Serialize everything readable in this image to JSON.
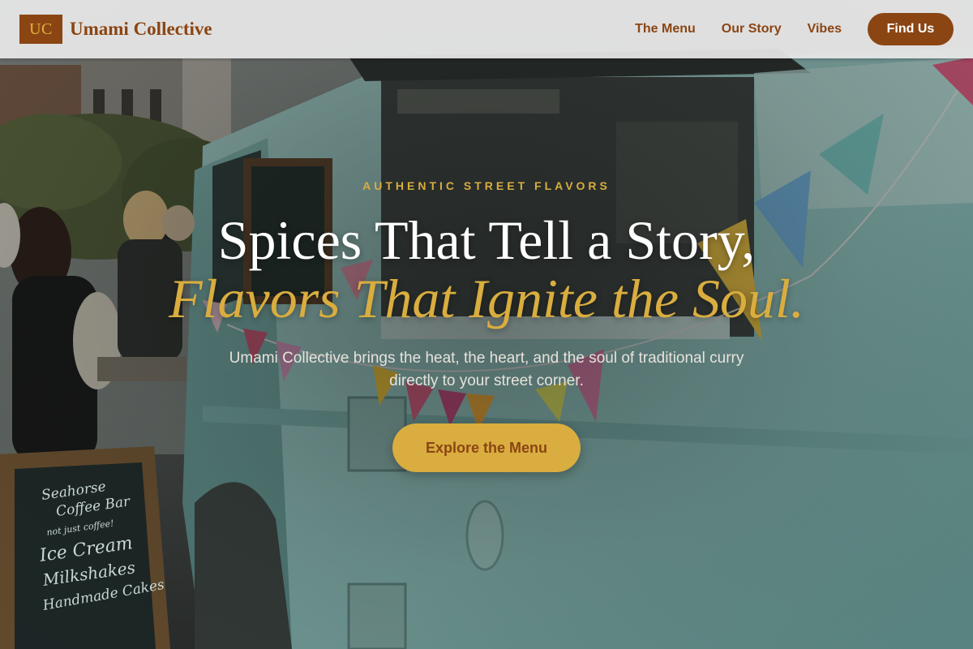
{
  "header": {
    "logo_mark": "UC",
    "brand_name": "Umami Collective",
    "nav": [
      {
        "label": "The Menu"
      },
      {
        "label": "Our Story"
      },
      {
        "label": "Vibes"
      }
    ],
    "cta_label": "Find Us"
  },
  "hero": {
    "eyebrow": "AUTHENTIC STREET FLAVORS",
    "headline_line1": "Spices That Tell a Story,",
    "headline_line2": "Flavors That Ignite the Soul.",
    "subtext": "Umami Collective brings the heat, the heart, and the soul of traditional curry directly to your street corner.",
    "cta_label": "Explore the Menu",
    "background_image": "food-truck-photo",
    "sandwich_board": [
      "Seahorse",
      "Coffee Bar",
      "not just coffee!",
      "Ice Cream",
      "Milkshakes",
      "Handmade Cakes"
    ]
  },
  "colors": {
    "brand_brown": "#8b4513",
    "accent_gold": "#d9ad3f",
    "header_bg": "#e8e8e8",
    "truck_teal": "#8fc4c0"
  }
}
